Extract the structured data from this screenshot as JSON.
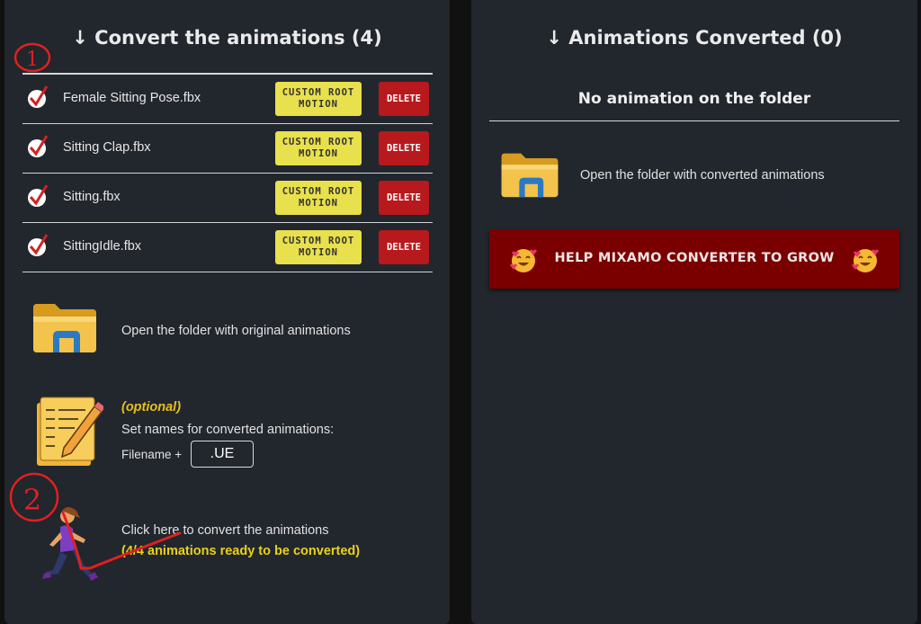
{
  "left_panel": {
    "title": "↓ Convert the animations (4)",
    "animations": [
      {
        "name": "Female Sitting Pose.fbx",
        "custom_root_label": "CUSTOM ROOT MOTION",
        "delete_label": "DELETE"
      },
      {
        "name": "Sitting Clap.fbx",
        "custom_root_label": "CUSTOM ROOT MOTION",
        "delete_label": "DELETE"
      },
      {
        "name": "Sitting.fbx",
        "custom_root_label": "CUSTOM ROOT MOTION",
        "delete_label": "DELETE"
      },
      {
        "name": "SittingIdle.fbx",
        "custom_root_label": "CUSTOM ROOT MOTION",
        "delete_label": "DELETE"
      }
    ],
    "open_original_label": "Open the folder with original animations",
    "names": {
      "optional": "(optional)",
      "label": "Set names for converted animations:",
      "prefix": "Filename +",
      "suffix_value": ".UE"
    },
    "convert": {
      "label": "Click here to convert the animations",
      "status": "(4/4 animations ready to be converted)"
    }
  },
  "right_panel": {
    "title": "↓ Animations Converted (0)",
    "empty_message": "No animation on the folder",
    "open_converted_label": "Open the folder with converted animations",
    "help_button_label": "HELP MIXAMO CONVERTER TO GROW"
  },
  "annotations": {
    "step1": "1",
    "step2": "2"
  },
  "icons": {
    "folder": "folder-icon",
    "notepad": "notepad-pencil-icon",
    "runner": "running-woman-icon",
    "check": "checkmark-icon",
    "hearts_face": "smiling-face-with-hearts-icon"
  },
  "colors": {
    "panel_bg": "#22262d",
    "custom_root": "#e8e04c",
    "delete": "#b8191d",
    "help_button": "#7a0000",
    "accent_text": "#ead11a",
    "annotation_red": "#e02020"
  }
}
